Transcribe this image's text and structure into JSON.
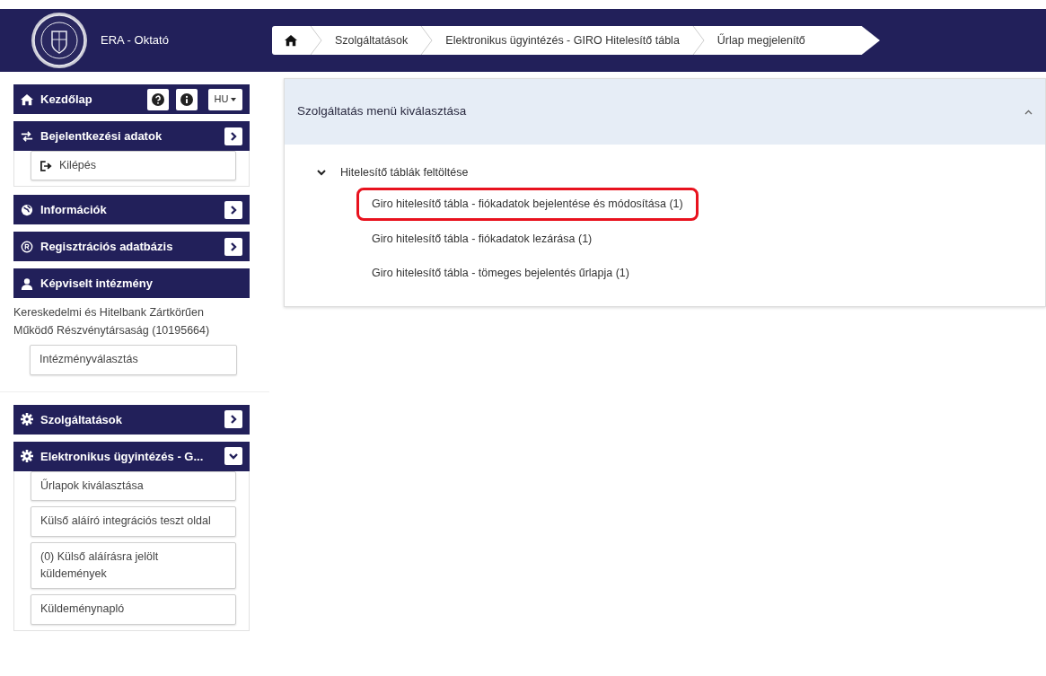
{
  "header": {
    "title": "ERA - Oktató"
  },
  "breadcrumb": [
    {
      "kind": "home"
    },
    {
      "kind": "text",
      "label": "Szolgáltatások"
    },
    {
      "kind": "text",
      "label": "Elektronikus ügyintézés - GIRO Hitelesítő tábla"
    },
    {
      "kind": "text",
      "label": "Űrlap megjelenítő"
    }
  ],
  "sidebar": {
    "home": {
      "label": "Kezdőlap",
      "language": "HU"
    },
    "groups": [
      [
        {
          "kind": "toggle",
          "title": "Bejelentkezési adatok",
          "expanded": false,
          "items": [
            {
              "kind": "logout",
              "label": "Kilépés"
            }
          ]
        },
        {
          "kind": "toggle",
          "title": "Információk",
          "expanded": false
        },
        {
          "kind": "toggle",
          "title": "Regisztrációs adatbázis",
          "expanded": false
        },
        {
          "kind": "plain",
          "title": "Képviselt intézmény",
          "text": "Kereskedelmi és Hitelbank Zártkörűen Működő Részvénytársaság (10195664)",
          "items": [
            {
              "kind": "link",
              "label": "Intézményválasztás"
            }
          ]
        }
      ],
      [
        {
          "kind": "toggle",
          "title": "Szolgáltatások",
          "expanded": false
        },
        {
          "kind": "toggle",
          "title": "Elektronikus ügyintézés - G...",
          "expanded": true,
          "items": [
            {
              "kind": "link",
              "label": "Űrlapok kiválasztása"
            },
            {
              "kind": "link",
              "label": "Külső aláíró integrációs teszt oldal"
            },
            {
              "kind": "link",
              "label": "(0) Külső aláírásra jelölt küldemények"
            },
            {
              "kind": "link",
              "label": "Küldeménynapló"
            }
          ]
        }
      ]
    ]
  },
  "panel": {
    "title": "Szolgáltatás menü kiválasztása",
    "expanded": true,
    "tree": [
      {
        "label": "Hitelesítő táblák feltöltése",
        "expanded": true,
        "children": [
          {
            "label": "Giro hitelesítő tábla - fiókadatok bejelentése és módosítása (1)",
            "highlighted": true
          },
          {
            "label": "Giro hitelesítő tábla - fiókadatok lezárása (1)",
            "highlighted": false
          },
          {
            "label": "Giro hitelesítő tábla - tömeges bejelentés űrlapja (1)",
            "highlighted": false
          }
        ]
      }
    ]
  }
}
